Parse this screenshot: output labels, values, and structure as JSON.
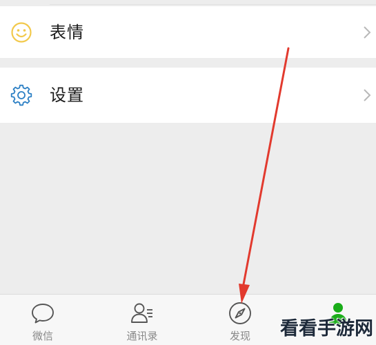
{
  "menu": {
    "emoji_label": "表情",
    "settings_label": "设置"
  },
  "tabbar": {
    "chats_label": "微信",
    "contacts_label": "通讯录",
    "discover_label": "发现"
  },
  "watermark": "看看手游网",
  "colors": {
    "accent_green": "#1aad19",
    "emoji_yellow": "#f2c94c",
    "settings_blue": "#2b7fc4",
    "arrow_red": "#e23a2e"
  },
  "icons": {
    "emoji": "smiley-icon",
    "settings": "gear-icon",
    "chats": "chat-bubble-icon",
    "contacts": "contacts-icon",
    "discover": "compass-icon",
    "me": "person-icon"
  }
}
